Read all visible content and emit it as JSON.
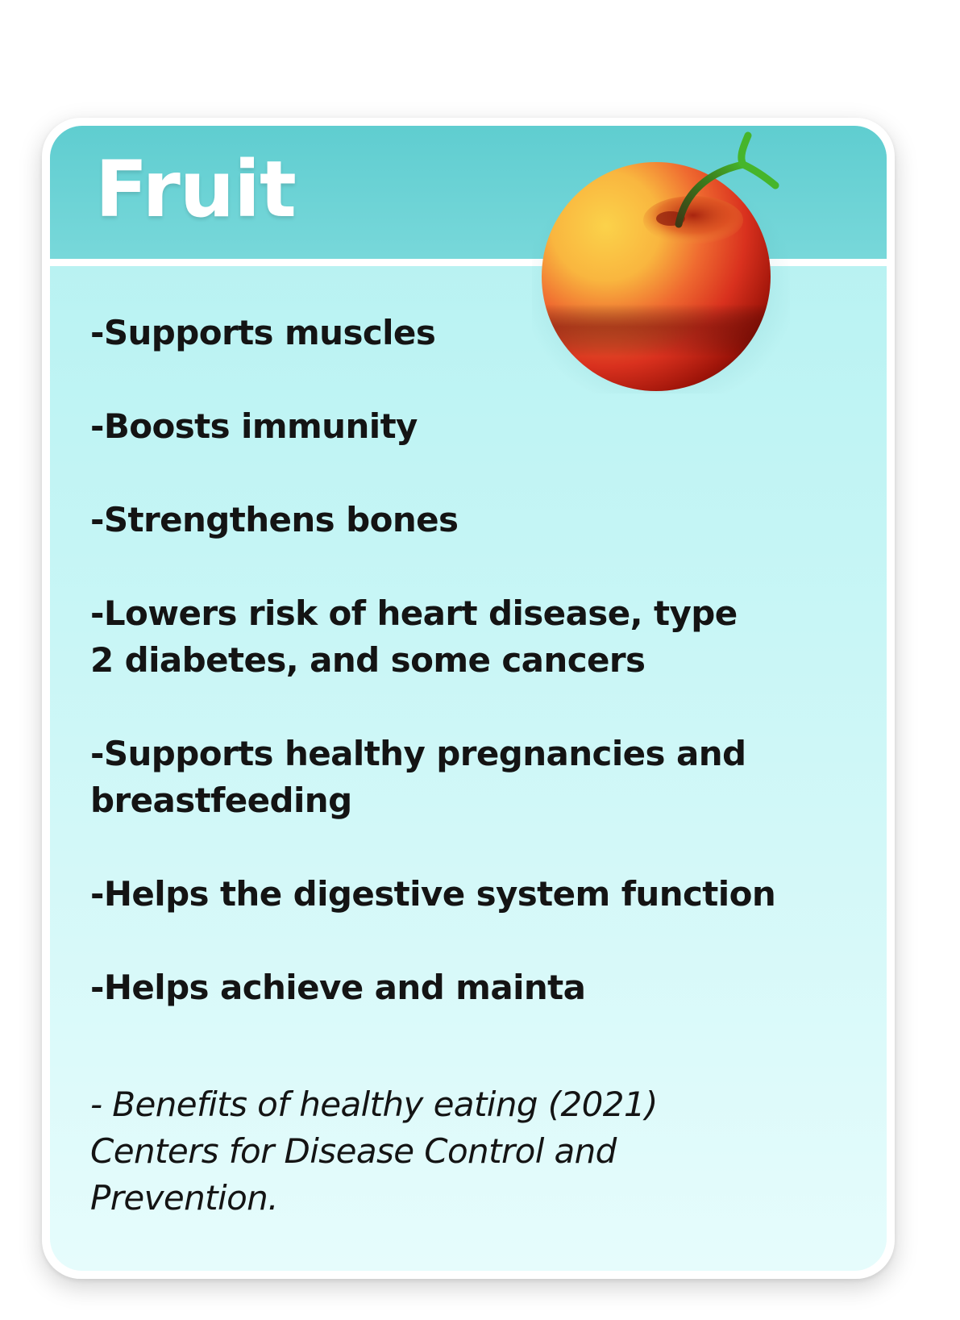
{
  "card": {
    "title": "Fruit",
    "benefits": [
      "-Supports muscles",
      "-Boosts immunity",
      "-Strengthens bones",
      "-Lowers risk of heart disease, type\n 2 diabetes, and some cancers",
      "-Supports healthy pregnancies and\nbreastfeeding",
      "-Helps the digestive system function",
      "-Helps achieve and mainta"
    ],
    "citation": "- Benefits of healthy eating (2021)\nCenters for Disease Control and\nPrevention."
  },
  "illustration": {
    "icon": "apple-icon"
  },
  "colors": {
    "header": "#5fcdd0",
    "body_top": "#b3f1f1",
    "body_bottom": "#e6fcfc",
    "title": "#ffffff",
    "text": "#141414",
    "apple_red": "#d8331f",
    "apple_yellow": "#f7c842",
    "stem_green": "#3fa428"
  }
}
